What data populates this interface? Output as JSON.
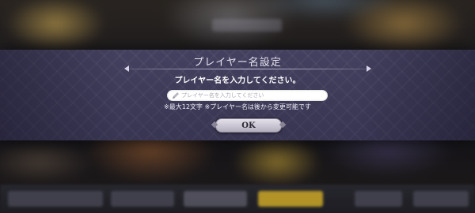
{
  "dialog": {
    "title": "プレイヤー名設定",
    "instruction": "プレイヤー名を入力してください。",
    "input": {
      "value": "",
      "placeholder": "プレイヤー名を入力してください"
    },
    "note": "※最大12文字 ※プレイヤー名は後から変更可能です",
    "ok_label": "OK"
  },
  "icons": {
    "input_icon": "pencil-icon"
  },
  "colors": {
    "dialog_band": "#444160",
    "ok_button": "#c9c5d2",
    "highlight_button": "#e1b928"
  }
}
